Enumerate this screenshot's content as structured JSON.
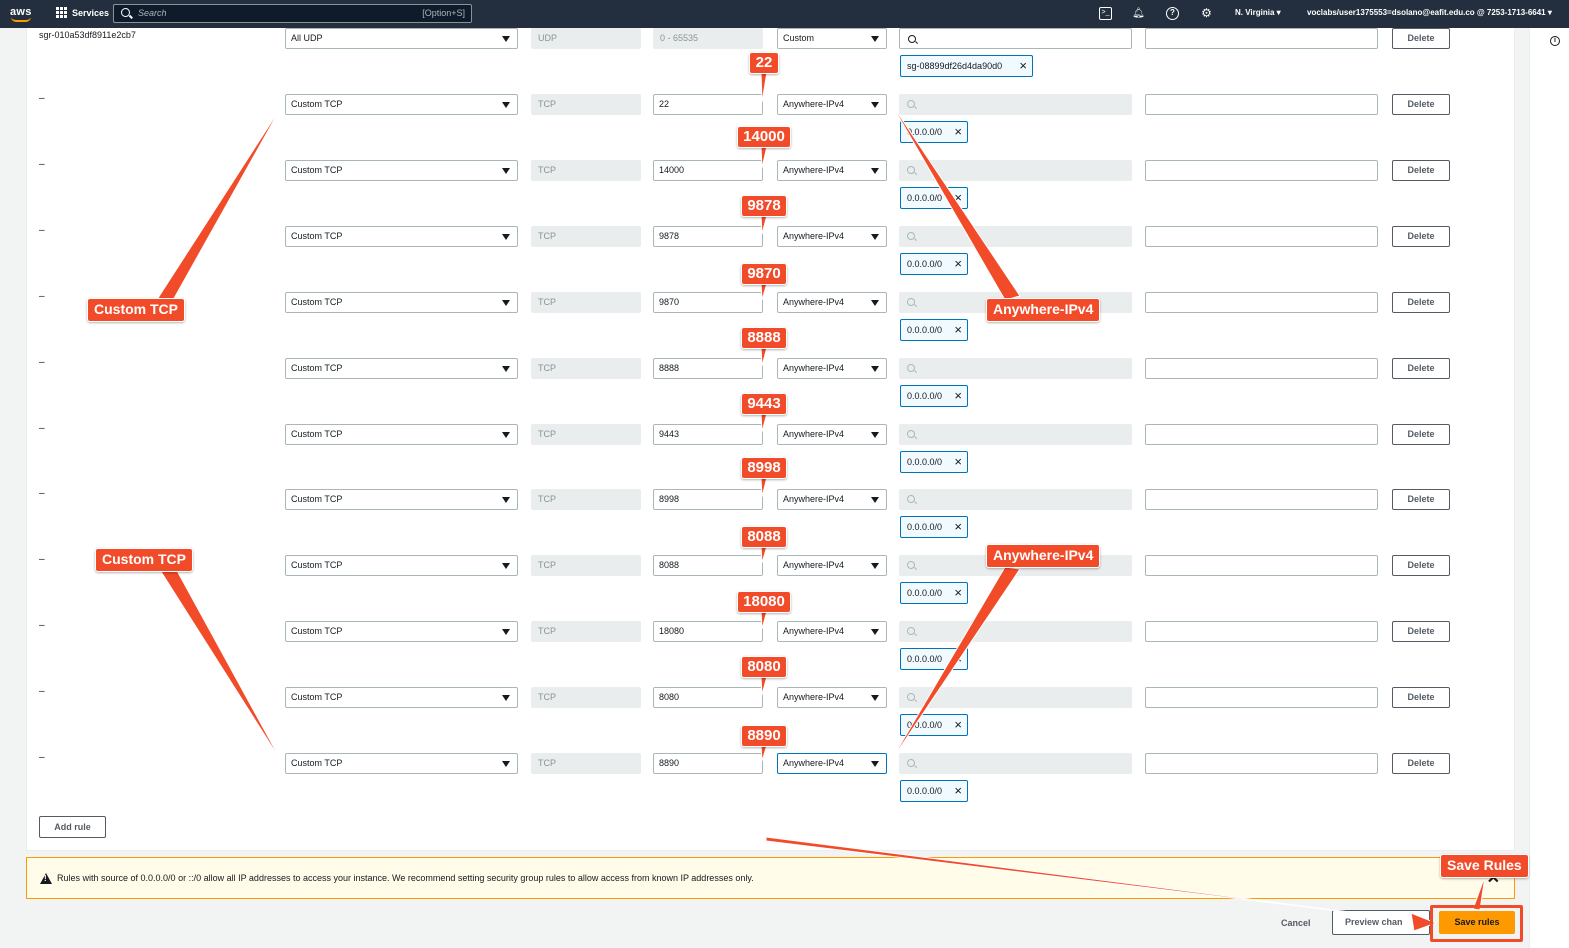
{
  "topnav": {
    "logo": "aws",
    "services_label": "Services",
    "search_placeholder": "Search",
    "search_shortcut": "[Option+S]",
    "region": "N. Virginia ▾",
    "account": "voclabs/user1375553=dsolano@eafit.edu.co @ 7253-1713-6641 ▾",
    "icons": [
      "cloudshell-icon",
      "bell-icon",
      "help-icon",
      "gear-icon"
    ]
  },
  "first_rule": {
    "id": "sgr-010a53df8911e2cb7",
    "type": "All UDP",
    "protocol": "UDP",
    "port_range": "0 - 65535",
    "source_type": "Custom",
    "source_token": "sg-08899df26d4da90d0",
    "delete_label": "Delete"
  },
  "rules": [
    {
      "id": "–",
      "type": "Custom TCP",
      "protocol": "TCP",
      "port": "22",
      "source_type": "Anywhere-IPv4",
      "cidr": "0.0.0.0/0",
      "delete_label": "Delete"
    },
    {
      "id": "–",
      "type": "Custom TCP",
      "protocol": "TCP",
      "port": "14000",
      "source_type": "Anywhere-IPv4",
      "cidr": "0.0.0.0/0",
      "delete_label": "Delete"
    },
    {
      "id": "–",
      "type": "Custom TCP",
      "protocol": "TCP",
      "port": "9878",
      "source_type": "Anywhere-IPv4",
      "cidr": "0.0.0.0/0",
      "delete_label": "Delete"
    },
    {
      "id": "–",
      "type": "Custom TCP",
      "protocol": "TCP",
      "port": "9870",
      "source_type": "Anywhere-IPv4",
      "cidr": "0.0.0.0/0",
      "delete_label": "Delete"
    },
    {
      "id": "–",
      "type": "Custom TCP",
      "protocol": "TCP",
      "port": "8888",
      "source_type": "Anywhere-IPv4",
      "cidr": "0.0.0.0/0",
      "delete_label": "Delete"
    },
    {
      "id": "–",
      "type": "Custom TCP",
      "protocol": "TCP",
      "port": "9443",
      "source_type": "Anywhere-IPv4",
      "cidr": "0.0.0.0/0",
      "delete_label": "Delete"
    },
    {
      "id": "–",
      "type": "Custom TCP",
      "protocol": "TCP",
      "port": "8998",
      "source_type": "Anywhere-IPv4",
      "cidr": "0.0.0.0/0",
      "delete_label": "Delete"
    },
    {
      "id": "–",
      "type": "Custom TCP",
      "protocol": "TCP",
      "port": "8088",
      "source_type": "Anywhere-IPv4",
      "cidr": "0.0.0.0/0",
      "delete_label": "Delete"
    },
    {
      "id": "–",
      "type": "Custom TCP",
      "protocol": "TCP",
      "port": "18080",
      "source_type": "Anywhere-IPv4",
      "cidr": "0.0.0.0/0",
      "delete_label": "Delete"
    },
    {
      "id": "–",
      "type": "Custom TCP",
      "protocol": "TCP",
      "port": "8080",
      "source_type": "Anywhere-IPv4",
      "cidr": "0.0.0.0/0",
      "delete_label": "Delete"
    },
    {
      "id": "–",
      "type": "Custom TCP",
      "protocol": "TCP",
      "port": "8890",
      "source_type": "Anywhere-IPv4",
      "cidr": "0.0.0.0/0",
      "delete_label": "Delete"
    }
  ],
  "add_rule_label": "Add rule",
  "warning": {
    "text": "Rules with source of 0.0.0.0/0 or ::/0 allow all IP addresses to access your instance. We recommend setting security group rules to allow access from known IP addresses only."
  },
  "footer": {
    "cancel_label": "Cancel",
    "preview_label": "Preview chan",
    "save_label": "Save rules"
  },
  "annotations": {
    "type_label": "Custom TCP",
    "source_label": "Anywhere-IPv4",
    "save_label": "Save Rules",
    "ports": [
      "22",
      "14000",
      "9878",
      "9870",
      "8888",
      "9443",
      "8998",
      "8088",
      "18080",
      "8080",
      "8890"
    ],
    "color": "#f24b2a"
  }
}
